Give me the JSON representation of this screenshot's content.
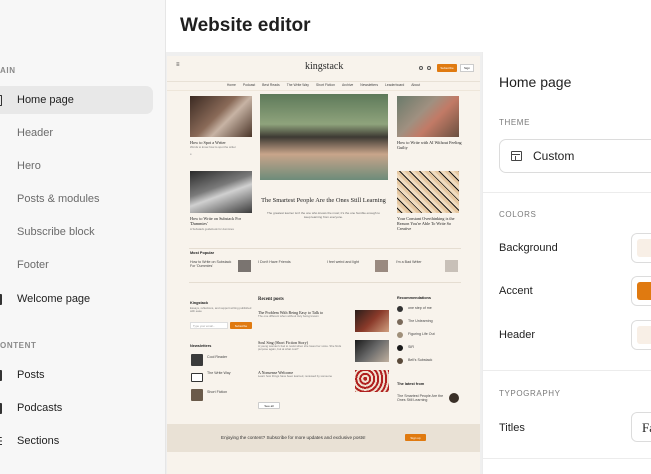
{
  "window": {
    "title": "Website editor"
  },
  "sidebar": {
    "sections": [
      {
        "label": "AIN"
      },
      {
        "label": "ONTENT"
      }
    ],
    "items": [
      {
        "label": "Home page"
      },
      {
        "label": "Header"
      },
      {
        "label": "Hero"
      },
      {
        "label": "Posts & modules"
      },
      {
        "label": "Subscribe block"
      },
      {
        "label": "Footer"
      },
      {
        "label": "Welcome page"
      },
      {
        "label": "Posts"
      },
      {
        "label": "Podcasts"
      },
      {
        "label": "Sections"
      }
    ],
    "active_item": "Home page"
  },
  "preview": {
    "logo": "kingstack",
    "subscribe_label": "Subscribe",
    "signin_label": "Sign",
    "nav": [
      "Home",
      "Podcast",
      "Best Reads",
      "The Write Way",
      "Short Fiction",
      "Archive",
      "Newsletters",
      "Leaderboard",
      "About"
    ],
    "left_posts": [
      {
        "title": "How to Spot a Writer",
        "desc": "Words to know how to spot the writer"
      },
      {
        "title": "How to Write on Substack For 'Dummies'",
        "desc": "A Substack guidebook for dummies"
      }
    ],
    "right_posts": [
      {
        "title": "How to Write with AI Without Feeling Guilty"
      },
      {
        "title": "Your Constant Overthinking is the Reason You're Able To Write So Creative"
      }
    ],
    "hero": {
      "title": "The Smartest People Are the Ones Still Learning",
      "desc": "The greatest learner isn't the one who knows the most; it's the one humble enough to keep learning from everyone."
    },
    "most_popular": {
      "label": "Most Popular",
      "items": [
        "How to Write on Substack For 'Dummies'",
        "I Don't Have Friends",
        "I feel weird and light",
        "I'm a Bad Writer"
      ]
    },
    "publication": {
      "name": "Kingstack",
      "desc": "Essays, reflections, and support writing published with ease",
      "email_placeholder": "Type your email...",
      "subscribe_label": "Subscribe"
    },
    "newsletters": {
      "label": "Newsletters",
      "items": [
        "Cool Reader",
        "The Write Way",
        "Short Fiction"
      ]
    },
    "recent_posts": {
      "label": "Recent posts",
      "items": [
        {
          "title": "The Problem With Being Easy to Talk to",
          "desc": "The one different when without truly being known"
        },
        {
          "title": "Soul Sing (Short Fiction Story)",
          "desc": "A young woman's fuel to resist when she loses her voice. She finds purpose again, but at what cost?"
        },
        {
          "title": "A Nonsense Welcome",
          "desc": "Learn how things have been learned, reviewed by someone"
        }
      ],
      "see_all_label": "See all"
    },
    "recommendations": {
      "label": "Recommendations",
      "items": [
        "one step of me",
        "The Unlearning",
        "Figuring Life Out",
        "SIR",
        "Bell's Substack"
      ]
    },
    "latest": {
      "label": "The latest from",
      "item": "The Smartest People Are the Ones Still Learning"
    },
    "footer": {
      "text": "Enjoying the content? Subscribe for more updates and exclusive posts!",
      "button": "Sign up"
    }
  },
  "panel": {
    "title": "Home page",
    "theme": {
      "label": "THEME",
      "value": "Custom"
    },
    "colors": {
      "label": "COLORS",
      "rows": [
        {
          "label": "Background",
          "color": "#f8efe6"
        },
        {
          "label": "Accent",
          "color": "#e07a10"
        },
        {
          "label": "Header",
          "color": "#f8efe6"
        }
      ]
    },
    "typography": {
      "label": "TYPOGRAPHY",
      "titles_label": "Titles",
      "titles_font_sample": "Fa"
    }
  },
  "icons": [
    "menu-icon",
    "layout-icon",
    "search-icon"
  ]
}
